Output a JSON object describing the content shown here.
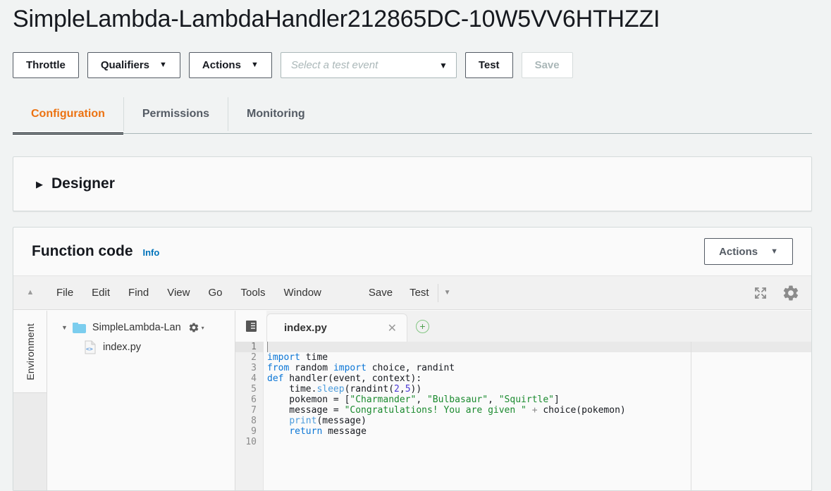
{
  "header": {
    "title": "SimpleLambda-LambdaHandler212865DC-10W5VV6HTHZZI",
    "buttons": {
      "throttle": "Throttle",
      "qualifiers": "Qualifiers",
      "actions": "Actions",
      "test": "Test",
      "save": "Save"
    },
    "test_event_select": {
      "placeholder": "Select a test event",
      "value": ""
    },
    "caret_glyph": "▼"
  },
  "tabs": [
    {
      "label": "Configuration",
      "active": true
    },
    {
      "label": "Permissions",
      "active": false
    },
    {
      "label": "Monitoring",
      "active": false
    }
  ],
  "designer": {
    "label": "Designer",
    "arrow_glyph": "▶",
    "expanded": false
  },
  "function_code": {
    "title": "Function code",
    "info_link": "Info",
    "actions_button": "Actions",
    "caret_glyph": "▼"
  },
  "editor": {
    "collapse_glyph": "▲",
    "menus": [
      "File",
      "Edit",
      "Find",
      "View",
      "Go",
      "Tools",
      "Window"
    ],
    "save_label": "Save",
    "test_label": "Test",
    "test_caret_glyph": "▼",
    "expand_icon": "expand-icon",
    "settings_icon": "gear-icon",
    "environment_label": "Environment",
    "tree": {
      "twisty_glyph": "▼",
      "root_name": "SimpleLambda-Lan",
      "root_gear_caret": "▾",
      "file_name": "index.py"
    },
    "tab": {
      "name": "index.py",
      "close_glyph": "✕",
      "add_glyph": "+"
    },
    "cursor_line": 1,
    "line_numbers": [
      "1",
      "2",
      "3",
      "4",
      "5",
      "6",
      "7",
      "8",
      "9",
      "10"
    ],
    "code_lines": [
      [],
      [
        {
          "t": "import",
          "c": "kw"
        },
        {
          "t": " time",
          "c": ""
        }
      ],
      [
        {
          "t": "from",
          "c": "kw"
        },
        {
          "t": " random ",
          "c": ""
        },
        {
          "t": "import",
          "c": "kw"
        },
        {
          "t": " choice, randint",
          "c": ""
        }
      ],
      [
        {
          "t": "def",
          "c": "kw"
        },
        {
          "t": " handler(event, context):",
          "c": ""
        }
      ],
      [
        {
          "t": "    time.",
          "c": ""
        },
        {
          "t": "sleep",
          "c": "fn"
        },
        {
          "t": "(randint(",
          "c": ""
        },
        {
          "t": "2",
          "c": "num"
        },
        {
          "t": ",",
          "c": ""
        },
        {
          "t": "5",
          "c": "num"
        },
        {
          "t": "))",
          "c": ""
        }
      ],
      [
        {
          "t": "    pokemon = [",
          "c": ""
        },
        {
          "t": "\"Charmander\"",
          "c": "str"
        },
        {
          "t": ", ",
          "c": ""
        },
        {
          "t": "\"Bulbasaur\"",
          "c": "str"
        },
        {
          "t": ", ",
          "c": ""
        },
        {
          "t": "\"Squirtle\"",
          "c": "str"
        },
        {
          "t": "]",
          "c": ""
        }
      ],
      [
        {
          "t": "    message = ",
          "c": ""
        },
        {
          "t": "\"Congratulations! You are given \"",
          "c": "str"
        },
        {
          "t": " ",
          "c": ""
        },
        {
          "t": "+",
          "c": "op"
        },
        {
          "t": " choice(pokemon)",
          "c": ""
        }
      ],
      [
        {
          "t": "    ",
          "c": ""
        },
        {
          "t": "print",
          "c": "fn"
        },
        {
          "t": "(message)",
          "c": ""
        }
      ],
      [
        {
          "t": "    ",
          "c": ""
        },
        {
          "t": "return",
          "c": "kw"
        },
        {
          "t": " message",
          "c": ""
        }
      ],
      []
    ]
  },
  "colors": {
    "accent_orange": "#ec7211",
    "link_blue": "#0073bb",
    "keyword_blue": "#0b76d6",
    "string_green": "#1a8a2e",
    "number_purple": "#4b3ad6",
    "folder_blue": "#7bcdee"
  }
}
